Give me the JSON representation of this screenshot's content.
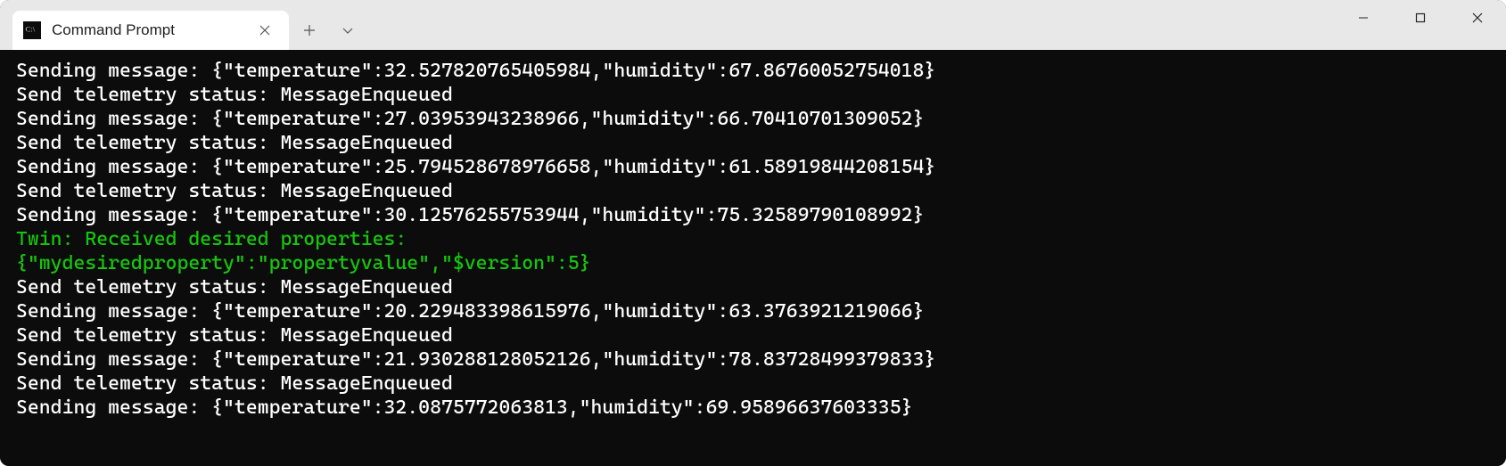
{
  "tab": {
    "title": "Command Prompt"
  },
  "terminal": {
    "lines": [
      {
        "text": "Sending message: {\"temperature\":32.527820765405984,\"humidity\":67.86760052754018}",
        "color": "white"
      },
      {
        "text": "Send telemetry status: MessageEnqueued",
        "color": "white"
      },
      {
        "text": "Sending message: {\"temperature\":27.03953943238966,\"humidity\":66.70410701309052}",
        "color": "white"
      },
      {
        "text": "Send telemetry status: MessageEnqueued",
        "color": "white"
      },
      {
        "text": "Sending message: {\"temperature\":25.794528678976658,\"humidity\":61.58919844208154}",
        "color": "white"
      },
      {
        "text": "Send telemetry status: MessageEnqueued",
        "color": "white"
      },
      {
        "text": "Sending message: {\"temperature\":30.12576255753944,\"humidity\":75.32589790108992}",
        "color": "white"
      },
      {
        "text": "Twin: Received desired properties:",
        "color": "green"
      },
      {
        "text": "{\"mydesiredproperty\":\"propertyvalue\",\"$version\":5}",
        "color": "green"
      },
      {
        "text": "Send telemetry status: MessageEnqueued",
        "color": "white"
      },
      {
        "text": "Sending message: {\"temperature\":20.229483398615976,\"humidity\":63.3763921219066}",
        "color": "white"
      },
      {
        "text": "Send telemetry status: MessageEnqueued",
        "color": "white"
      },
      {
        "text": "Sending message: {\"temperature\":21.930288128052126,\"humidity\":78.83728499379833}",
        "color": "white"
      },
      {
        "text": "Send telemetry status: MessageEnqueued",
        "color": "white"
      },
      {
        "text": "Sending message: {\"temperature\":32.0875772063813,\"humidity\":69.95896637603335}",
        "color": "white"
      }
    ]
  }
}
